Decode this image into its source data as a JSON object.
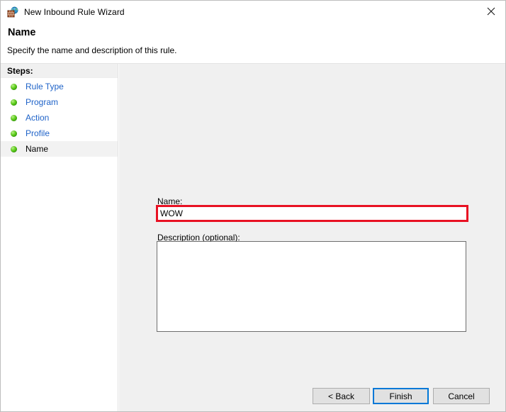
{
  "window": {
    "title": "New Inbound Rule Wizard",
    "title_icon": "firewall-globe-icon",
    "close_label": "close-icon"
  },
  "header": {
    "title": "Name",
    "subtitle": "Specify the name and description of this rule."
  },
  "sidebar": {
    "header": "Steps:",
    "items": [
      {
        "label": "Rule Type",
        "icon": "green-bullet-icon",
        "current": false
      },
      {
        "label": "Program",
        "icon": "green-bullet-icon",
        "current": false
      },
      {
        "label": "Action",
        "icon": "green-bullet-icon",
        "current": false
      },
      {
        "label": "Profile",
        "icon": "green-bullet-icon",
        "current": false
      },
      {
        "label": "Name",
        "icon": "green-bullet-icon",
        "current": true
      }
    ]
  },
  "main": {
    "name_field": {
      "label": "Name:",
      "value": "WOW",
      "placeholder": "",
      "highlighted": true,
      "highlight_color": "#e81123"
    },
    "description_field": {
      "label": "Description (optional):",
      "value": "",
      "placeholder": ""
    }
  },
  "footer": {
    "back_label": "< Back",
    "finish_label": "Finish",
    "cancel_label": "Cancel",
    "focus_color": "#0078d7"
  },
  "colors": {
    "content_background": "#f0f0f0",
    "sidebar_background": "#ffffff",
    "link_text": "#1f63c8",
    "button_face": "#e1e1e1"
  }
}
